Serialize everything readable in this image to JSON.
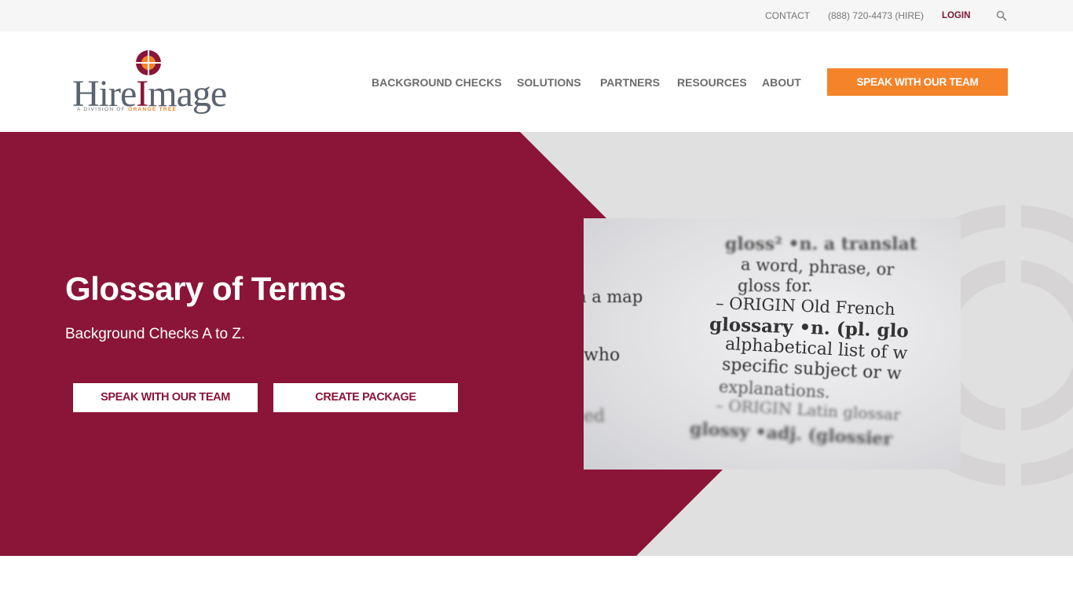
{
  "topbar": {
    "contact": "CONTACT",
    "phone": "(888) 720-4473 (HIRE)",
    "login": "LOGIN",
    "search_icon": "search-icon"
  },
  "logo": {
    "hire": "Hire",
    "i": "I",
    "mage": "mage",
    "tag_prefix": "A DIVISION OF ",
    "tag_brand": "ORANGE TREE"
  },
  "nav": {
    "items": [
      "BACKGROUND CHECKS",
      "SOLUTIONS",
      "PARTNERS",
      "RESOURCES",
      "ABOUT"
    ],
    "cta": "SPEAK WITH OUR TEAM"
  },
  "hero": {
    "title": "Glossary of Terms",
    "subtitle": "Background Checks A to Z.",
    "buttons": [
      "SPEAK WITH OUR TEAM",
      "CREATE PACKAGE"
    ],
    "image": {
      "lines": [
        "gloss² •n. a translat",
        "a word, phrase, or",
        "gloss for.",
        "– ORIGIN Old French",
        "glossary •n. (pl. glo",
        "alphabetical list of w",
        "specific subject or w",
        "explanations.",
        "– ORIGIN Latin glossar",
        "glossy •adj. (glossier",
        "h a map",
        "who",
        "ed"
      ]
    }
  },
  "colors": {
    "brand_red": "#8a1538",
    "orange": "#f4832a",
    "hero_gray": "#e0e0e0"
  }
}
